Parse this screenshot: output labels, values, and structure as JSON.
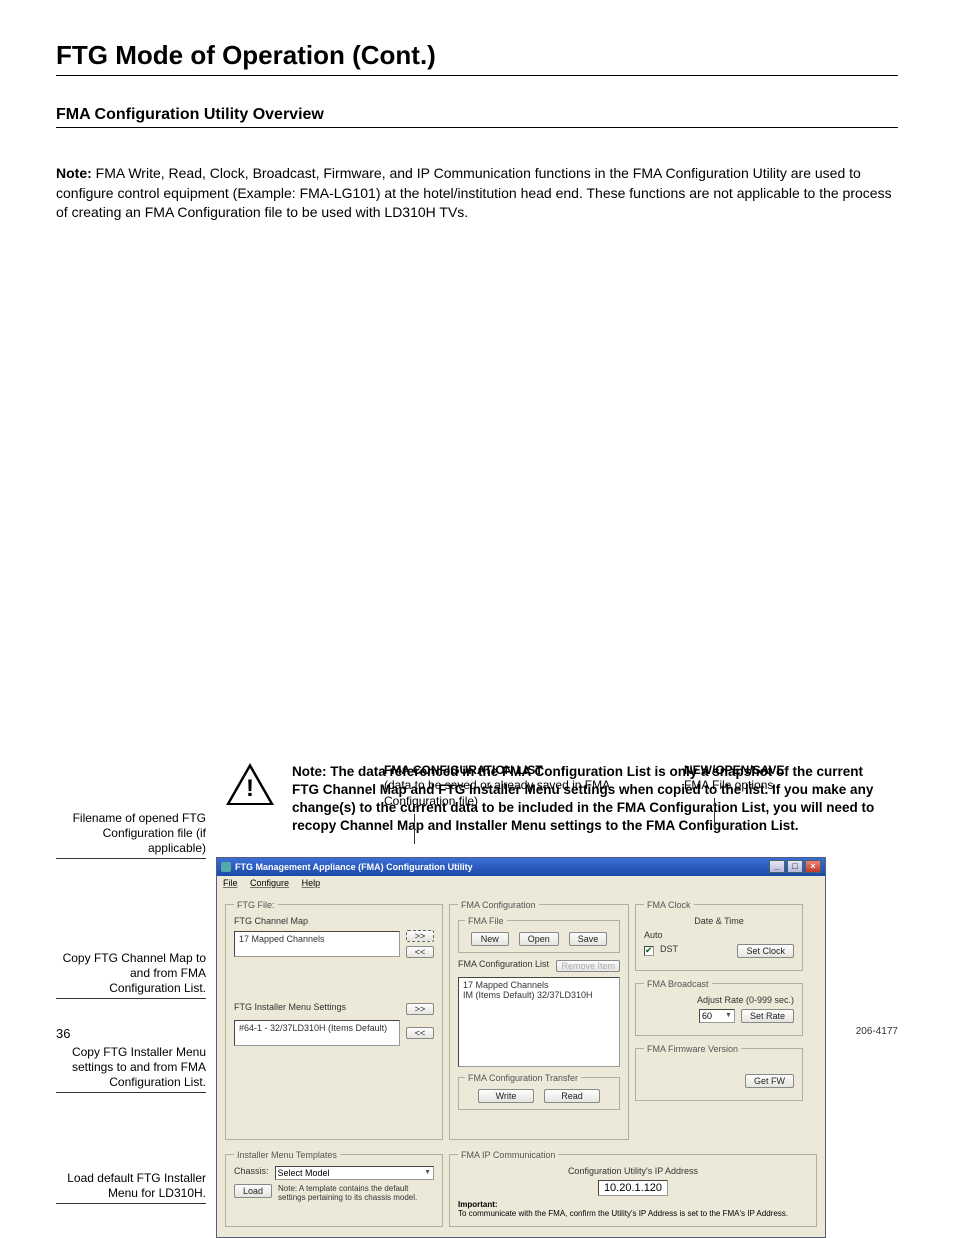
{
  "page": {
    "title": "FTG Mode of Operation (Cont.)",
    "subtitle": "FMA Configuration Utility Overview",
    "note_label": "Note:",
    "note_body": " FMA Write, Read, Clock, Broadcast, Firmware, and IP Communication functions in the FMA Configuration Utility are used to configure control equipment (Example: FMA-LG101) at the hotel/institution head end. These functions are not applicable to the process of creating an FMA Configuration file to be used with LD310H TVs.",
    "footer_page": "36",
    "footer_doc": "206-4177"
  },
  "legends": {
    "filename": "Filename of opened FTG Configuration file (if applicable)",
    "copy_map": "Copy FTG Channel Map to and from FMA Configuration List.",
    "copy_installer": "Copy FTG Installer Menu settings to and from FMA Configuration List.",
    "load_default": "Load default FTG Installer Menu for LD310H.",
    "config_list_title": "FMA CONFIGURATION LIST",
    "config_list_sub": "(data to be saved or already saved in FMA Configuration file)",
    "newopensave_title": "NEW/OPEN/SAVE",
    "newopensave_sub": "FMA File options"
  },
  "app": {
    "title": "FTG Management Appliance (FMA) Configuration Utility",
    "menu": {
      "file": "File",
      "configure": "Configure",
      "help": "Help"
    },
    "ftg_file": {
      "legend": "FTG File:",
      "channel_map_label": "FTG Channel Map",
      "channel_map_list": "17 Mapped Channels",
      "btn_right": ">>",
      "btn_left": "<<",
      "installer_label": "FTG Installer Menu Settings",
      "installer_list": "#64-1 - 32/37LD310H (Items Default)"
    },
    "fma_config": {
      "legend": "FMA Configuration",
      "file_legend": "FMA File",
      "btn_new": "New",
      "btn_open": "Open",
      "btn_save": "Save",
      "list_label": "FMA Configuration List",
      "btn_remove": "Remove Item",
      "list_line1": "17 Mapped Channels",
      "list_line2": "IM (Items Default) 32/37LD310H",
      "transfer_legend": "FMA Configuration Transfer",
      "btn_write": "Write",
      "btn_read": "Read"
    },
    "clock": {
      "legend": "FMA Clock",
      "datetime": "Date & Time",
      "auto": "Auto",
      "dst": "DST",
      "btn_setclock": "Set Clock"
    },
    "broadcast": {
      "legend": "FMA Broadcast",
      "hint": "Adjust Rate (0-999 sec.)",
      "rate_value": "60",
      "btn_setrate": "Set Rate"
    },
    "firmware": {
      "legend": "FMA Firmware Version",
      "btn_getfw": "Get FW"
    },
    "templates": {
      "legend": "Installer Menu Templates",
      "chassis_label": "Chassis:",
      "chassis_value": "Select Model",
      "btn_load": "Load",
      "note": "Note:  A template contains the default settings pertaining to its chassis model."
    },
    "ipcomm": {
      "legend": "FMA IP Communication",
      "ip_label": "Configuration Utility's IP Address",
      "ip_value": "10.20.1.120",
      "important_label": "Important:",
      "important_text": "To communicate with the FMA, confirm the Utility's IP Address is set to the FMA's IP Address."
    }
  },
  "warning": {
    "text": "Note: The data referenced in the FMA Configuration List is only a snapshot of the current FTG Channel Map and FTG Installer Menu settings when copied to the list. If you make any change(s) to the current data to be included in the FMA Configuration List, you will need to recopy Channel Map and Installer Menu settings to the FMA Configuration List."
  }
}
